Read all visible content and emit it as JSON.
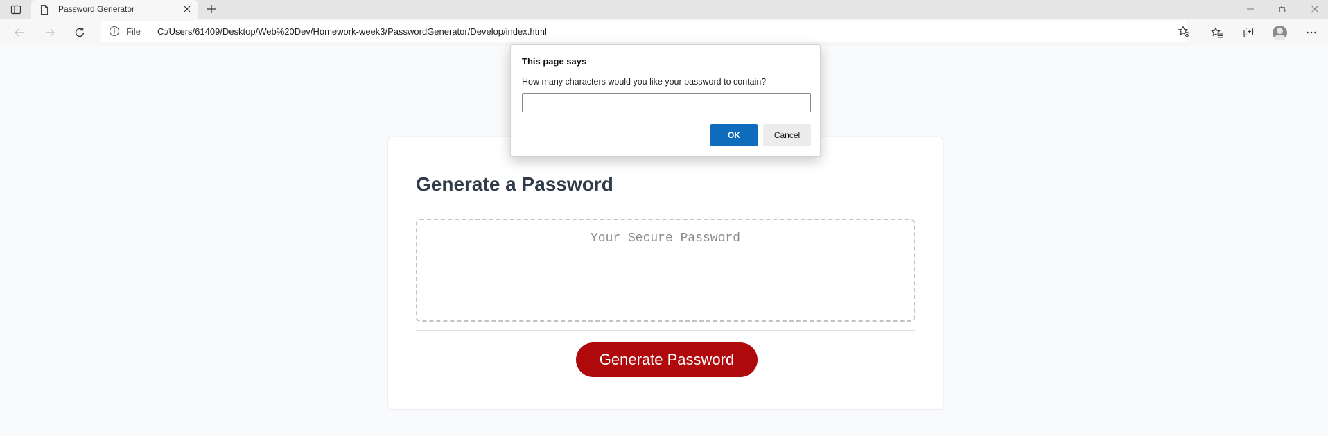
{
  "browser": {
    "tab_title": "Password Generator",
    "scheme_label": "File",
    "url": "C:/Users/61409/Desktop/Web%20Dev/Homework-week3/PasswordGenerator/Develop/index.html",
    "icons": [
      "tab-actions-icon",
      "page-icon",
      "close-icon",
      "plus-icon",
      "minimize-icon",
      "restore-icon",
      "close-icon",
      "back-icon",
      "forward-icon",
      "refresh-icon",
      "info-icon",
      "add-favorite-icon",
      "favorites-icon",
      "collections-icon",
      "profile-icon",
      "more-icon"
    ]
  },
  "page": {
    "title": "Generate a Password",
    "password_placeholder": "Your Secure Password",
    "generate_button": "Generate Password",
    "colors": {
      "button": "#b0090c",
      "title": "#2f3b48",
      "background": "#f9fafb"
    }
  },
  "dialog": {
    "title": "This page says",
    "message": "How many characters would you like your password to contain?",
    "input_value": "",
    "ok_label": "OK",
    "cancel_label": "Cancel",
    "colors": {
      "ok": "#0f6cbd"
    }
  }
}
